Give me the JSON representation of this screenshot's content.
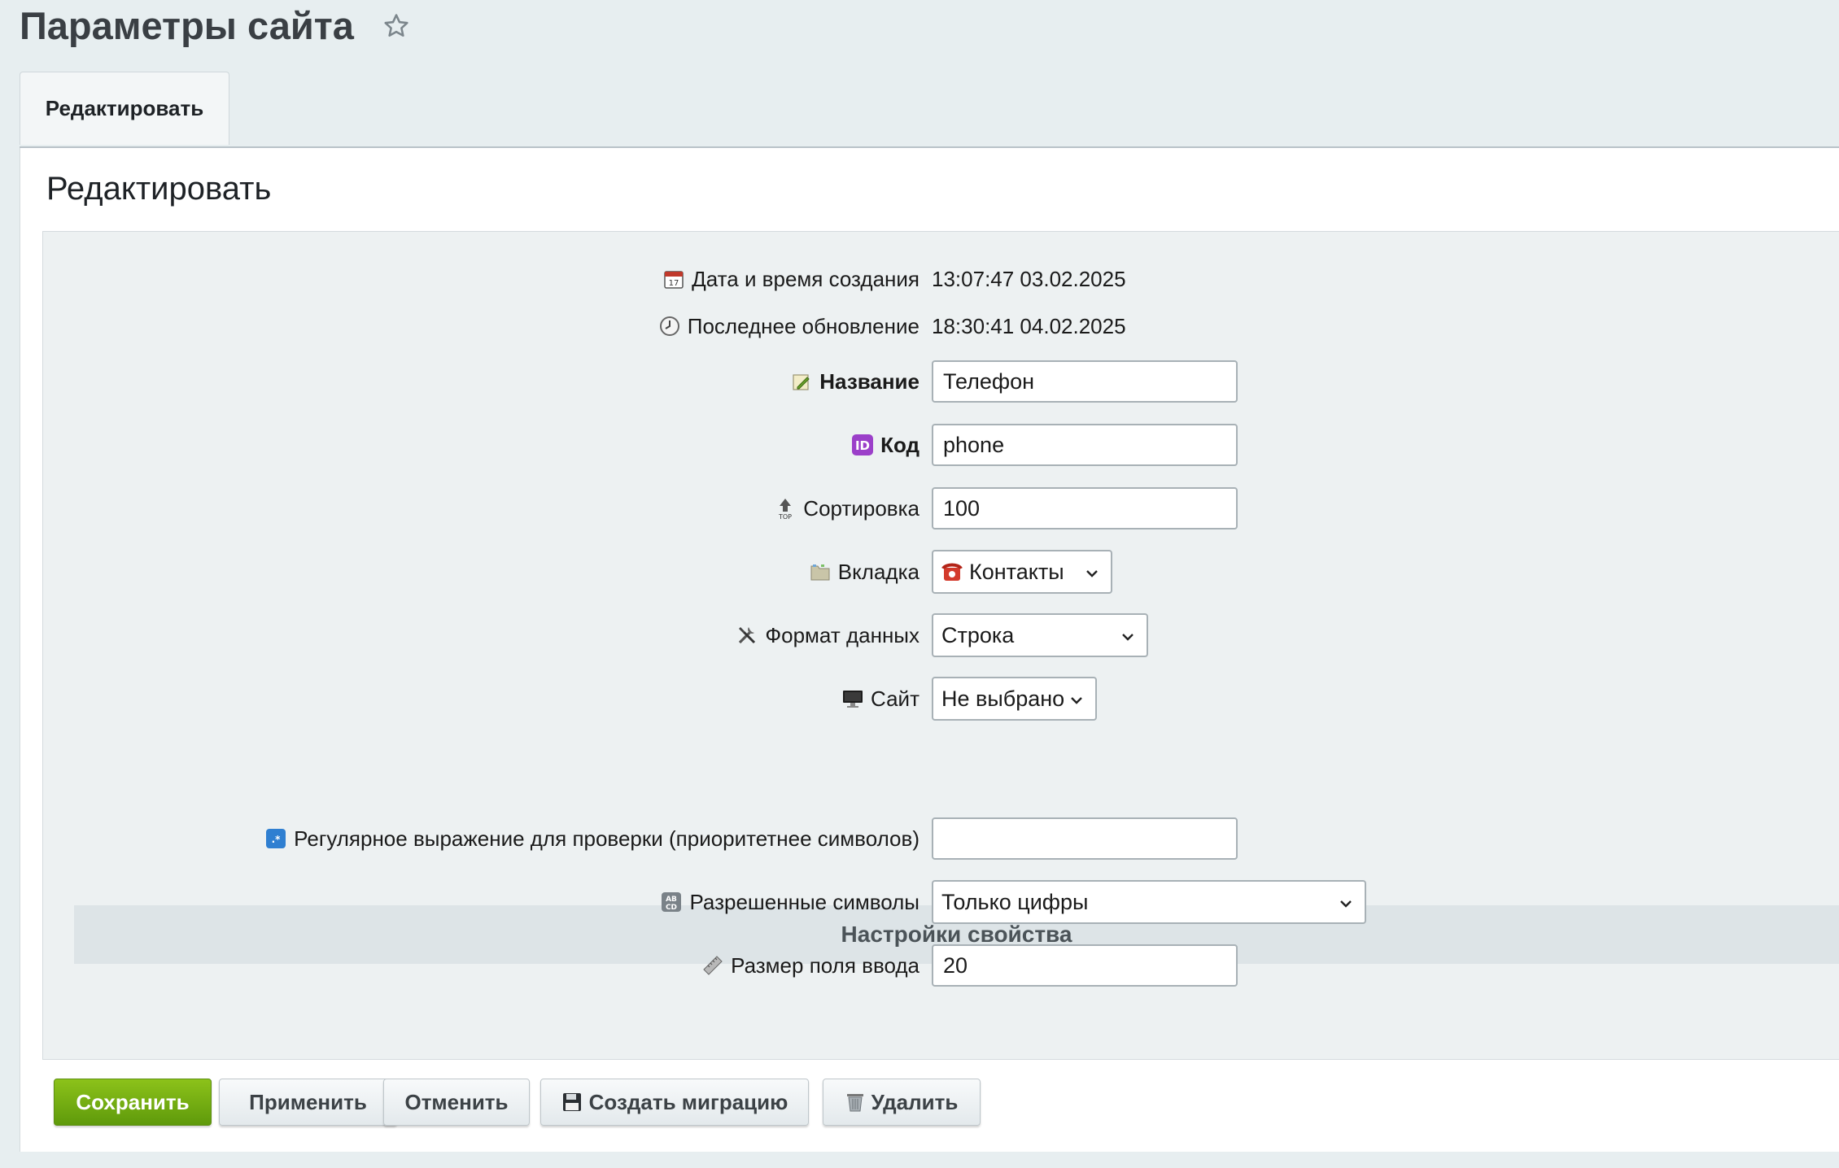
{
  "page": {
    "title": "Параметры сайта"
  },
  "tabs": [
    {
      "label": "Редактировать"
    }
  ],
  "panel": {
    "title": "Редактировать"
  },
  "fields": {
    "created": {
      "label": "Дата и время создания",
      "value": "13:07:47 03.02.2025",
      "icon": "calendar-icon"
    },
    "updated": {
      "label": "Последнее обновление",
      "value": "18:30:41 04.02.2025",
      "icon": "clock-icon"
    },
    "name": {
      "label": "Название",
      "value": "Телефон",
      "icon": "pencil-note-icon"
    },
    "code": {
      "label": "Код",
      "value": "phone",
      "icon": "id-icon"
    },
    "sort": {
      "label": "Сортировка",
      "value": "100",
      "icon": "sort-top-icon"
    },
    "tab": {
      "label": "Вкладка",
      "value": "Контакты",
      "icon": "folder-icon",
      "value_icon": "telephone-icon"
    },
    "format": {
      "label": "Формат данных",
      "value": "Строка",
      "icon": "tools-icon"
    },
    "site": {
      "label": "Сайт",
      "value": "Не выбрано",
      "icon": "monitor-icon"
    }
  },
  "section": {
    "title": "Настройки свойства"
  },
  "settings": {
    "regex": {
      "label": "Регулярное выражение для проверки (приоритетнее символов)",
      "value": "",
      "icon": "regex-icon"
    },
    "allowed": {
      "label": "Разрешенные символы",
      "value": "Только цифры",
      "icon": "abcd-icon"
    },
    "size": {
      "label": "Размер поля ввода",
      "value": "20",
      "icon": "ruler-icon"
    }
  },
  "buttons": {
    "save": "Сохранить",
    "apply": "Применить",
    "cancel": "Отменить",
    "migration": "Создать миграцию",
    "delete": "Удалить"
  },
  "colors": {
    "primary": "#6fab12",
    "background": "#e7eef0",
    "section": "#dde4e7"
  }
}
